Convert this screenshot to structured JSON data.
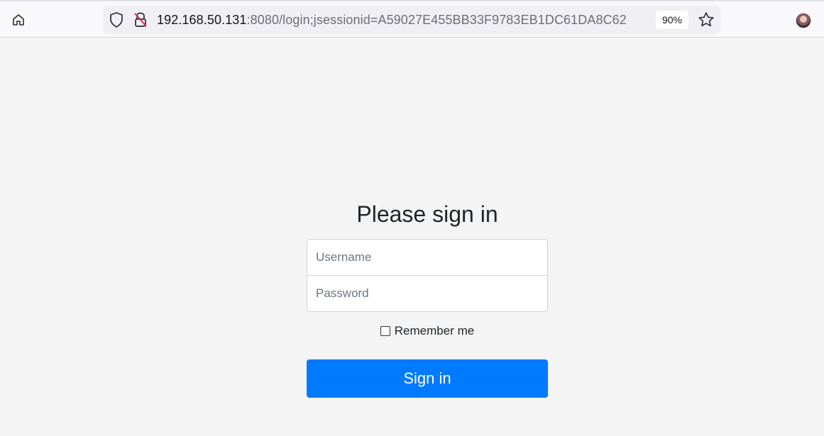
{
  "browser": {
    "url_host": "192.168.50.131",
    "url_rest": ":8080/login;jsessionid=A59027E455BB33F9783EB1DC61DA8C62",
    "zoom": "90%",
    "icons": [
      "home-icon",
      "shield-icon",
      "insecure-lock-icon",
      "bookmark-star-icon",
      "profile-avatar"
    ]
  },
  "login": {
    "heading": "Please sign in",
    "username_placeholder": "Username",
    "username_value": "",
    "password_placeholder": "Password",
    "password_value": "",
    "remember_label": "Remember me",
    "remember_checked": false,
    "submit_label": "Sign in"
  },
  "colors": {
    "primary": "#007bff",
    "background": "#f4f4f4",
    "insecure": "#e22850"
  }
}
